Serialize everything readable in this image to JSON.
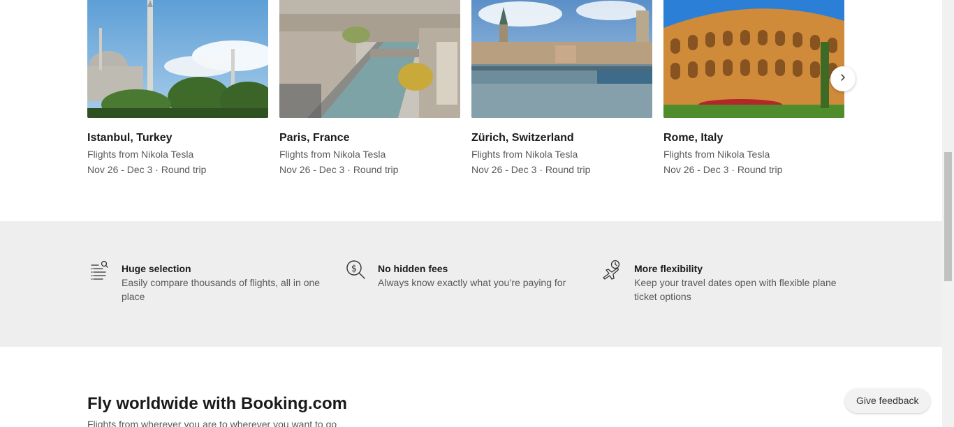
{
  "destinations": [
    {
      "title": "Istanbul, Turkey",
      "subtitle": "Flights from Nikola Tesla",
      "dates": "Nov 26 - Dec 3 · Round trip"
    },
    {
      "title": "Paris, France",
      "subtitle": "Flights from Nikola Tesla",
      "dates": "Nov 26 - Dec 3 · Round trip"
    },
    {
      "title": "Zürich, Switzerland",
      "subtitle": "Flights from Nikola Tesla",
      "dates": "Nov 26 - Dec 3 · Round trip"
    },
    {
      "title": "Rome, Italy",
      "subtitle": "Flights from Nikola Tesla",
      "dates": "Nov 26 - Dec 3 · Round trip"
    }
  ],
  "carousel": {
    "next_icon": "chevron-right-icon"
  },
  "features": [
    {
      "icon": "list-search-icon",
      "title": "Huge selection",
      "description": "Easily compare thousands of flights, all in one place"
    },
    {
      "icon": "dollar-search-icon",
      "title": "No hidden fees",
      "description": "Always know exactly what you’re paying for"
    },
    {
      "icon": "plane-clock-icon",
      "title": "More flexibility",
      "description": "Keep your travel dates open with flexible plane ticket options"
    }
  ],
  "section": {
    "heading": "Fly worldwide with Booking.com",
    "subheading": "Flights from wherever you are to wherever you want to go"
  },
  "feedback_button": {
    "label": "Give feedback"
  },
  "colors": {
    "band_background": "#eeeeee",
    "text_primary": "#1a1a1a",
    "text_secondary": "#595959"
  }
}
